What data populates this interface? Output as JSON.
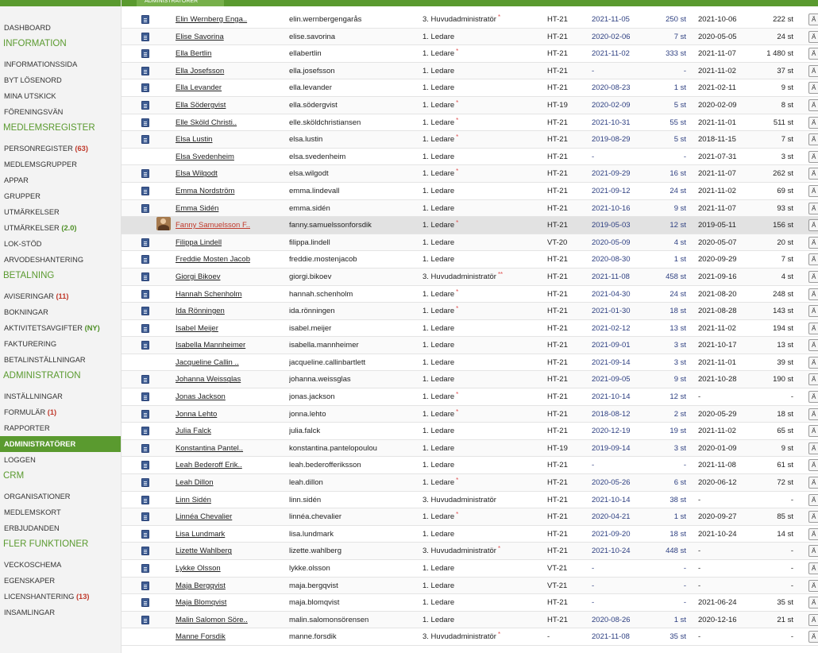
{
  "header": {
    "active_tab": "Administratörer"
  },
  "sidebar": {
    "items": [
      {
        "type": "item",
        "label": "Dashboard"
      },
      {
        "type": "section",
        "label": "Information"
      },
      {
        "type": "item",
        "label": "Informationssida"
      },
      {
        "type": "item",
        "label": "Byt lösenord"
      },
      {
        "type": "item",
        "label": "Mina utskick"
      },
      {
        "type": "item",
        "label": "Föreningsvän"
      },
      {
        "type": "section",
        "label": "Medlemsregister"
      },
      {
        "type": "item",
        "label": "Personregister",
        "count": "(63)",
        "count_style": "red"
      },
      {
        "type": "item",
        "label": "Medlemsgrupper"
      },
      {
        "type": "item",
        "label": "Appar"
      },
      {
        "type": "item",
        "label": "Grupper"
      },
      {
        "type": "item",
        "label": "Utmärkelser"
      },
      {
        "type": "item",
        "label": "Utmärkelser",
        "count": "(2.0)",
        "count_style": "green"
      },
      {
        "type": "item",
        "label": "LOK-stöd"
      },
      {
        "type": "item",
        "label": "Arvodeshantering"
      },
      {
        "type": "section",
        "label": "Betalning"
      },
      {
        "type": "item",
        "label": "Aviseringar",
        "count": "(11)",
        "count_style": "red"
      },
      {
        "type": "item",
        "label": "Bokningar"
      },
      {
        "type": "item",
        "label": "Aktivitetsavgifter",
        "count": "(NY)",
        "count_style": "green"
      },
      {
        "type": "item",
        "label": "Fakturering"
      },
      {
        "type": "item",
        "label": "Betalinställningar"
      },
      {
        "type": "section",
        "label": "Administration"
      },
      {
        "type": "item",
        "label": "Inställningar"
      },
      {
        "type": "item",
        "label": "Formulär",
        "count": "(1)",
        "count_style": "red"
      },
      {
        "type": "item",
        "label": "Rapporter"
      },
      {
        "type": "item",
        "label": "Administratörer",
        "active": true
      },
      {
        "type": "item",
        "label": "Loggen"
      },
      {
        "type": "section",
        "label": "CRM"
      },
      {
        "type": "item",
        "label": "Organisationer"
      },
      {
        "type": "item",
        "label": "Medlemskort"
      },
      {
        "type": "item",
        "label": "Erbjudanden"
      },
      {
        "type": "section",
        "label": "Fler funktioner"
      },
      {
        "type": "item",
        "label": "Veckoschema"
      },
      {
        "type": "item",
        "label": "Egenskaper"
      },
      {
        "type": "item",
        "label": "Licenshantering",
        "count": "(13)",
        "count_style": "red"
      },
      {
        "type": "item",
        "label": "Insamlingar"
      }
    ]
  },
  "table": {
    "button_label": "Ä",
    "rows": [
      {
        "icon": "card",
        "name": "Elin Wernberg Enga..",
        "username": "elin.wernbergengarås",
        "role": "3. Huvudadministratör",
        "star": "*",
        "class": "HT-21",
        "date1": "2021-11-05",
        "st1": "250 st",
        "date2": "2021-10-06",
        "st2": "222 st"
      },
      {
        "icon": "card",
        "name": "Elise Savorina",
        "username": "elise.savorina",
        "role": "1. Ledare",
        "star": "",
        "class": "HT-21",
        "date1": "2020-02-06",
        "st1": "7 st",
        "date2": "2020-05-05",
        "st2": "24 st"
      },
      {
        "icon": "card",
        "name": "Ella Bertlin",
        "username": "ellabertlin",
        "role": "1. Ledare",
        "star": "*",
        "class": "HT-21",
        "date1": "2021-11-02",
        "st1": "333 st",
        "date2": "2021-11-07",
        "st2": "1 480 st"
      },
      {
        "icon": "card",
        "name": "Ella Josefsson",
        "username": "ella.josefsson",
        "role": "1. Ledare",
        "star": "",
        "class": "HT-21",
        "date1": "-",
        "st1": "-",
        "date2": "2021-11-02",
        "st2": "37 st"
      },
      {
        "icon": "card",
        "name": "Ella Levander",
        "username": "ella.levander",
        "role": "1. Ledare",
        "star": "",
        "class": "HT-21",
        "date1": "2020-08-23",
        "st1": "1 st",
        "date2": "2021-02-11",
        "st2": "9 st"
      },
      {
        "icon": "card",
        "name": "Ella Södergvist",
        "username": "ella.södergvist",
        "role": "1. Ledare",
        "star": "*",
        "class": "HT-19",
        "date1": "2020-02-09",
        "st1": "5 st",
        "date2": "2020-02-09",
        "st2": "8 st"
      },
      {
        "icon": "card",
        "name": "Elle Sköld Christi..",
        "username": "elle.sköldchristiansen",
        "role": "1. Ledare",
        "star": "*",
        "class": "HT-21",
        "date1": "2021-10-31",
        "st1": "55 st",
        "date2": "2021-11-01",
        "st2": "511 st"
      },
      {
        "icon": "card",
        "name": "Elsa Lustin",
        "username": "elsa.lustin",
        "role": "1. Ledare",
        "star": "*",
        "class": "HT-21",
        "date1": "2019-08-29",
        "st1": "5 st",
        "date2": "2018-11-15",
        "st2": "7 st"
      },
      {
        "icon": "none",
        "name": "Elsa Svedenheim",
        "username": "elsa.svedenheim",
        "role": "1. Ledare",
        "star": "",
        "class": "HT-21",
        "date1": "-",
        "st1": "-",
        "date2": "2021-07-31",
        "st2": "3 st"
      },
      {
        "icon": "card",
        "name": "Elsa Wilgodt",
        "username": "elsa.wilgodt",
        "role": "1. Ledare",
        "star": "*",
        "class": "HT-21",
        "date1": "2021-09-29",
        "st1": "16 st",
        "date2": "2021-11-07",
        "st2": "262 st"
      },
      {
        "icon": "card",
        "name": "Emma Nordström",
        "username": "emma.lindevall",
        "role": "1. Ledare",
        "star": "",
        "class": "HT-21",
        "date1": "2021-09-12",
        "st1": "24 st",
        "date2": "2021-11-02",
        "st2": "69 st"
      },
      {
        "icon": "card",
        "name": "Emma Sidén",
        "username": "emma.sidén",
        "role": "1. Ledare",
        "star": "",
        "class": "HT-21",
        "date1": "2021-10-16",
        "st1": "9 st",
        "date2": "2021-11-07",
        "st2": "93 st"
      },
      {
        "icon": "photo",
        "name": "Fanny Samuelsson F..",
        "username": "fanny.samuelssonforsdik",
        "role": "1. Ledare",
        "star": "*",
        "class": "HT-21",
        "date1": "2019-05-03",
        "st1": "12 st",
        "date2": "2019-05-11",
        "st2": "156 st",
        "highlight": true
      },
      {
        "icon": "card",
        "name": "Filippa Lindell",
        "username": "filippa.lindell",
        "role": "1. Ledare",
        "star": "",
        "class": "VT-20",
        "date1": "2020-05-09",
        "st1": "4 st",
        "date2": "2020-05-07",
        "st2": "20 st"
      },
      {
        "icon": "card",
        "name": "Freddie Mosten Jacob",
        "username": "freddie.mostenjacob",
        "role": "1. Ledare",
        "star": "",
        "class": "HT-21",
        "date1": "2020-08-30",
        "st1": "1 st",
        "date2": "2020-09-29",
        "st2": "7 st"
      },
      {
        "icon": "card",
        "name": "Giorgi Bikoev",
        "username": "giorgi.bikoev",
        "role": "3. Huvudadministratör",
        "star": "**",
        "class": "HT-21",
        "date1": "2021-11-08",
        "st1": "458 st",
        "date2": "2021-09-16",
        "st2": "4 st"
      },
      {
        "icon": "card",
        "name": "Hannah Schenholm",
        "username": "hannah.schenholm",
        "role": "1. Ledare",
        "star": "*",
        "class": "HT-21",
        "date1": "2021-04-30",
        "st1": "24 st",
        "date2": "2021-08-20",
        "st2": "248 st"
      },
      {
        "icon": "card",
        "name": "Ida Rönningen",
        "username": "ida.rönningen",
        "role": "1. Ledare",
        "star": "*",
        "class": "HT-21",
        "date1": "2021-01-30",
        "st1": "18 st",
        "date2": "2021-08-28",
        "st2": "143 st"
      },
      {
        "icon": "card",
        "name": "Isabel Meijer",
        "username": "isabel.meijer",
        "role": "1. Ledare",
        "star": "",
        "class": "HT-21",
        "date1": "2021-02-12",
        "st1": "13 st",
        "date2": "2021-11-02",
        "st2": "194 st"
      },
      {
        "icon": "card",
        "name": "Isabella Mannheimer",
        "username": "isabella.mannheimer",
        "role": "1. Ledare",
        "star": "",
        "class": "HT-21",
        "date1": "2021-09-01",
        "st1": "3 st",
        "date2": "2021-10-17",
        "st2": "13 st"
      },
      {
        "icon": "none",
        "name": "Jacqueline Callin ..",
        "username": "jacqueline.callinbartlett",
        "role": "1. Ledare",
        "star": "",
        "class": "HT-21",
        "date1": "2021-09-14",
        "st1": "3 st",
        "date2": "2021-11-01",
        "st2": "39 st"
      },
      {
        "icon": "card",
        "name": "Johanna Weissglas",
        "username": "johanna.weissglas",
        "role": "1. Ledare",
        "star": "",
        "class": "HT-21",
        "date1": "2021-09-05",
        "st1": "9 st",
        "date2": "2021-10-28",
        "st2": "190 st"
      },
      {
        "icon": "card",
        "name": "Jonas Jackson",
        "username": "jonas.jackson",
        "role": "1. Ledare",
        "star": "*",
        "class": "HT-21",
        "date1": "2021-10-14",
        "st1": "12 st",
        "date2": "-",
        "st2": "-"
      },
      {
        "icon": "card",
        "name": "Jonna Lehto",
        "username": "jonna.lehto",
        "role": "1. Ledare",
        "star": "*",
        "class": "HT-21",
        "date1": "2018-08-12",
        "st1": "2 st",
        "date2": "2020-05-29",
        "st2": "18 st"
      },
      {
        "icon": "card",
        "name": "Julia Falck",
        "username": "julia.falck",
        "role": "1. Ledare",
        "star": "",
        "class": "HT-21",
        "date1": "2020-12-19",
        "st1": "19 st",
        "date2": "2021-11-02",
        "st2": "65 st"
      },
      {
        "icon": "card",
        "name": "Konstantina Pantel..",
        "username": "konstantina.pantelopoulou",
        "role": "1. Ledare",
        "star": "",
        "class": "HT-19",
        "date1": "2019-09-14",
        "st1": "3 st",
        "date2": "2020-01-09",
        "st2": "9 st"
      },
      {
        "icon": "card",
        "name": "Leah Bederoff Erik..",
        "username": "leah.bederofferiksson",
        "role": "1. Ledare",
        "star": "",
        "class": "HT-21",
        "date1": "-",
        "st1": "-",
        "date2": "2021-11-08",
        "st2": "61 st"
      },
      {
        "icon": "card",
        "name": "Leah Dillon",
        "username": "leah.dillon",
        "role": "1. Ledare",
        "star": "*",
        "class": "HT-21",
        "date1": "2020-05-26",
        "st1": "6 st",
        "date2": "2020-06-12",
        "st2": "72 st"
      },
      {
        "icon": "card",
        "name": "Linn Sidén",
        "username": "linn.sidén",
        "role": "3. Huvudadministratör",
        "star": "",
        "class": "HT-21",
        "date1": "2021-10-14",
        "st1": "38 st",
        "date2": "-",
        "st2": "-"
      },
      {
        "icon": "card",
        "name": "Linnéa Chevalier",
        "username": "linnéa.chevalier",
        "role": "1. Ledare",
        "star": "*",
        "class": "HT-21",
        "date1": "2020-04-21",
        "st1": "1 st",
        "date2": "2020-09-27",
        "st2": "85 st"
      },
      {
        "icon": "card",
        "name": "Lisa Lundmark",
        "username": "lisa.lundmark",
        "role": "1. Ledare",
        "star": "",
        "class": "HT-21",
        "date1": "2021-09-20",
        "st1": "18 st",
        "date2": "2021-10-24",
        "st2": "14 st"
      },
      {
        "icon": "card",
        "name": "Lizette Wahlberg",
        "username": "lizette.wahlberg",
        "role": "3. Huvudadministratör",
        "star": "*",
        "class": "HT-21",
        "date1": "2021-10-24",
        "st1": "448 st",
        "date2": "-",
        "st2": "-"
      },
      {
        "icon": "card",
        "name": "Lykke Olsson",
        "username": "lykke.olsson",
        "role": "1. Ledare",
        "star": "",
        "class": "VT-21",
        "date1": "-",
        "st1": "-",
        "date2": "-",
        "st2": "-"
      },
      {
        "icon": "card",
        "name": "Maja Bergqvist",
        "username": "maja.bergqvist",
        "role": "1. Ledare",
        "star": "",
        "class": "VT-21",
        "date1": "-",
        "st1": "-",
        "date2": "-",
        "st2": "-"
      },
      {
        "icon": "card",
        "name": "Maja Blomqvist",
        "username": "maja.blomqvist",
        "role": "1. Ledare",
        "star": "",
        "class": "HT-21",
        "date1": "-",
        "st1": "-",
        "date2": "2021-06-24",
        "st2": "35 st"
      },
      {
        "icon": "card",
        "name": "Malin Salomon Söre..",
        "username": "malin.salomonsörensen",
        "role": "1. Ledare",
        "star": "",
        "class": "HT-21",
        "date1": "2020-08-26",
        "st1": "1 st",
        "date2": "2020-12-16",
        "st2": "21 st"
      },
      {
        "icon": "none",
        "name": "Manne Forsdik",
        "username": "manne.forsdik",
        "role": "3. Huvudadministratör",
        "star": "*",
        "class": "-",
        "date1": "2021-11-08",
        "st1": "35 st",
        "date2": "-",
        "st2": "-"
      }
    ]
  }
}
